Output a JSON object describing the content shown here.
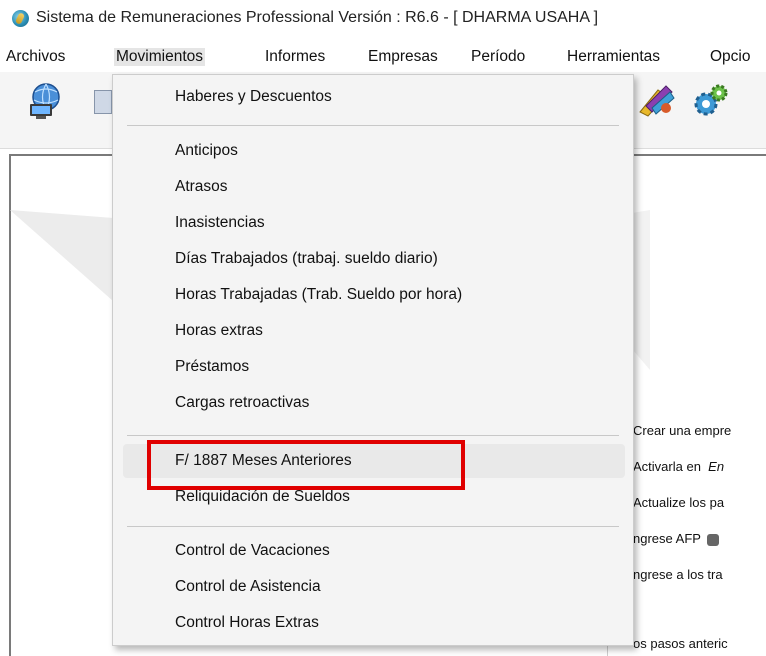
{
  "window": {
    "title": "Sistema de Remuneraciones Professional Versión : R6.6  - [ DHARMA USAHA ]"
  },
  "menubar": {
    "items": [
      "Archivos",
      "Movimientos",
      "Informes",
      "Empresas",
      "Período",
      "Herramientas",
      "Opcio"
    ],
    "active_item": "Movimientos"
  },
  "movimientos_menu": {
    "group1": [
      "Haberes y Descuentos"
    ],
    "group2": [
      "Anticipos",
      "Atrasos",
      "Inasistencias",
      "Días Trabajados (trabaj. sueldo diario)",
      "Horas Trabajadas (Trab. Sueldo por hora)",
      "Horas extras",
      "Préstamos",
      "Cargas retroactivas"
    ],
    "group3": [
      "F/ 1887 Meses Anteriores",
      "Reliquidación de Sueldos"
    ],
    "group4": [
      "Control de Vacaciones",
      "Control de Asistencia",
      "Control Horas Extras"
    ],
    "hovered_item": "F/ 1887 Meses Anteriores",
    "annotation_color": "#e00000"
  },
  "hints": {
    "lines": [
      "Crear una empre",
      "Activarla en",
      "Actualize los pa",
      "ngrese AFP",
      "ngrese a los tra",
      "os pasos anteric"
    ],
    "line2_emphasis": "En"
  },
  "toolbar": {
    "icons": [
      "globe-computer-icon",
      "book-icon",
      "tools-icon",
      "gears-icon"
    ]
  }
}
